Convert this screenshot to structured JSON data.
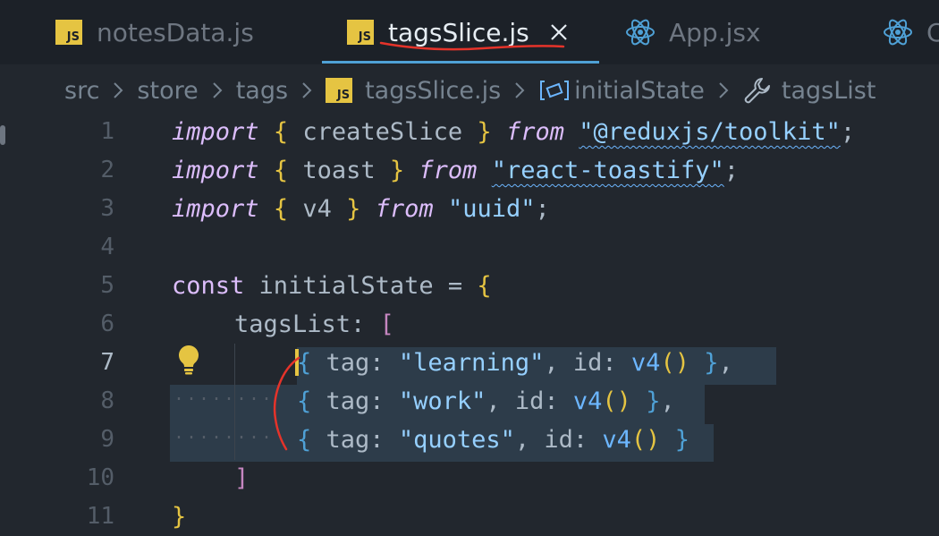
{
  "tabs": [
    {
      "label": "notesData.js",
      "icon": "js-icon",
      "active": false
    },
    {
      "label": "tagsSlice.js",
      "icon": "js-icon",
      "active": true
    },
    {
      "label": "App.jsx",
      "icon": "react-icon",
      "active": false
    },
    {
      "label": "C",
      "icon": "react-icon",
      "active": false
    }
  ],
  "js_badge_text": "JS",
  "breadcrumb": {
    "items": [
      "src",
      "store",
      "tags",
      "tagsSlice.js",
      "initialState",
      "tagsList"
    ]
  },
  "editor": {
    "line_numbers": [
      "1",
      "2",
      "3",
      "4",
      "5",
      "6",
      "7",
      "8",
      "9",
      "10",
      "11"
    ],
    "current_line": "7",
    "lines": {
      "l1": {
        "kw1": "import",
        "open": "{",
        "name": " createSlice ",
        "close": "}",
        "kw2": "from",
        "str": "\"@reduxjs/toolkit\"",
        "semi": ";"
      },
      "l2": {
        "kw1": "import",
        "open": "{",
        "name": " toast ",
        "close": "}",
        "kw2": "from",
        "str": "\"react-toastify\"",
        "semi": ";"
      },
      "l3": {
        "kw1": "import",
        "open": "{",
        "name": " v4 ",
        "close": "}",
        "kw2": "from",
        "str": "\"uuid\"",
        "semi": ";"
      },
      "l5": {
        "kw": "const",
        "name": " initialState = ",
        "open": "{"
      },
      "l6": {
        "prop": "tagsList: ",
        "open": "["
      },
      "l7": {
        "open": "{",
        "key": " tag: ",
        "str": "\"learning\"",
        "sep": ", id: ",
        "fn": "v4",
        "paren": "()",
        "close": "}",
        "tail": ","
      },
      "l8": {
        "open": "{",
        "key": " tag: ",
        "str": "\"work\"",
        "sep": ", id: ",
        "fn": "v4",
        "paren": "()",
        "close": "}",
        "tail": ","
      },
      "l9": {
        "open": "{",
        "key": " tag: ",
        "str": "\"quotes\"",
        "sep": ", id: ",
        "fn": "v4",
        "paren": "()",
        "close": "}",
        "tail": ""
      },
      "l10": {
        "close": "]"
      },
      "l11": {
        "close": "}"
      }
    }
  },
  "colors": {
    "background": "#22272e",
    "keyword": "#dcbdfb",
    "string": "#96d0ff",
    "function": "#6cb6ff",
    "bracket_yellow": "#e5c442",
    "bracket_purple": "#c586c0",
    "bracket_blue": "#4fa1d6",
    "annotation_red": "#e5332a"
  }
}
